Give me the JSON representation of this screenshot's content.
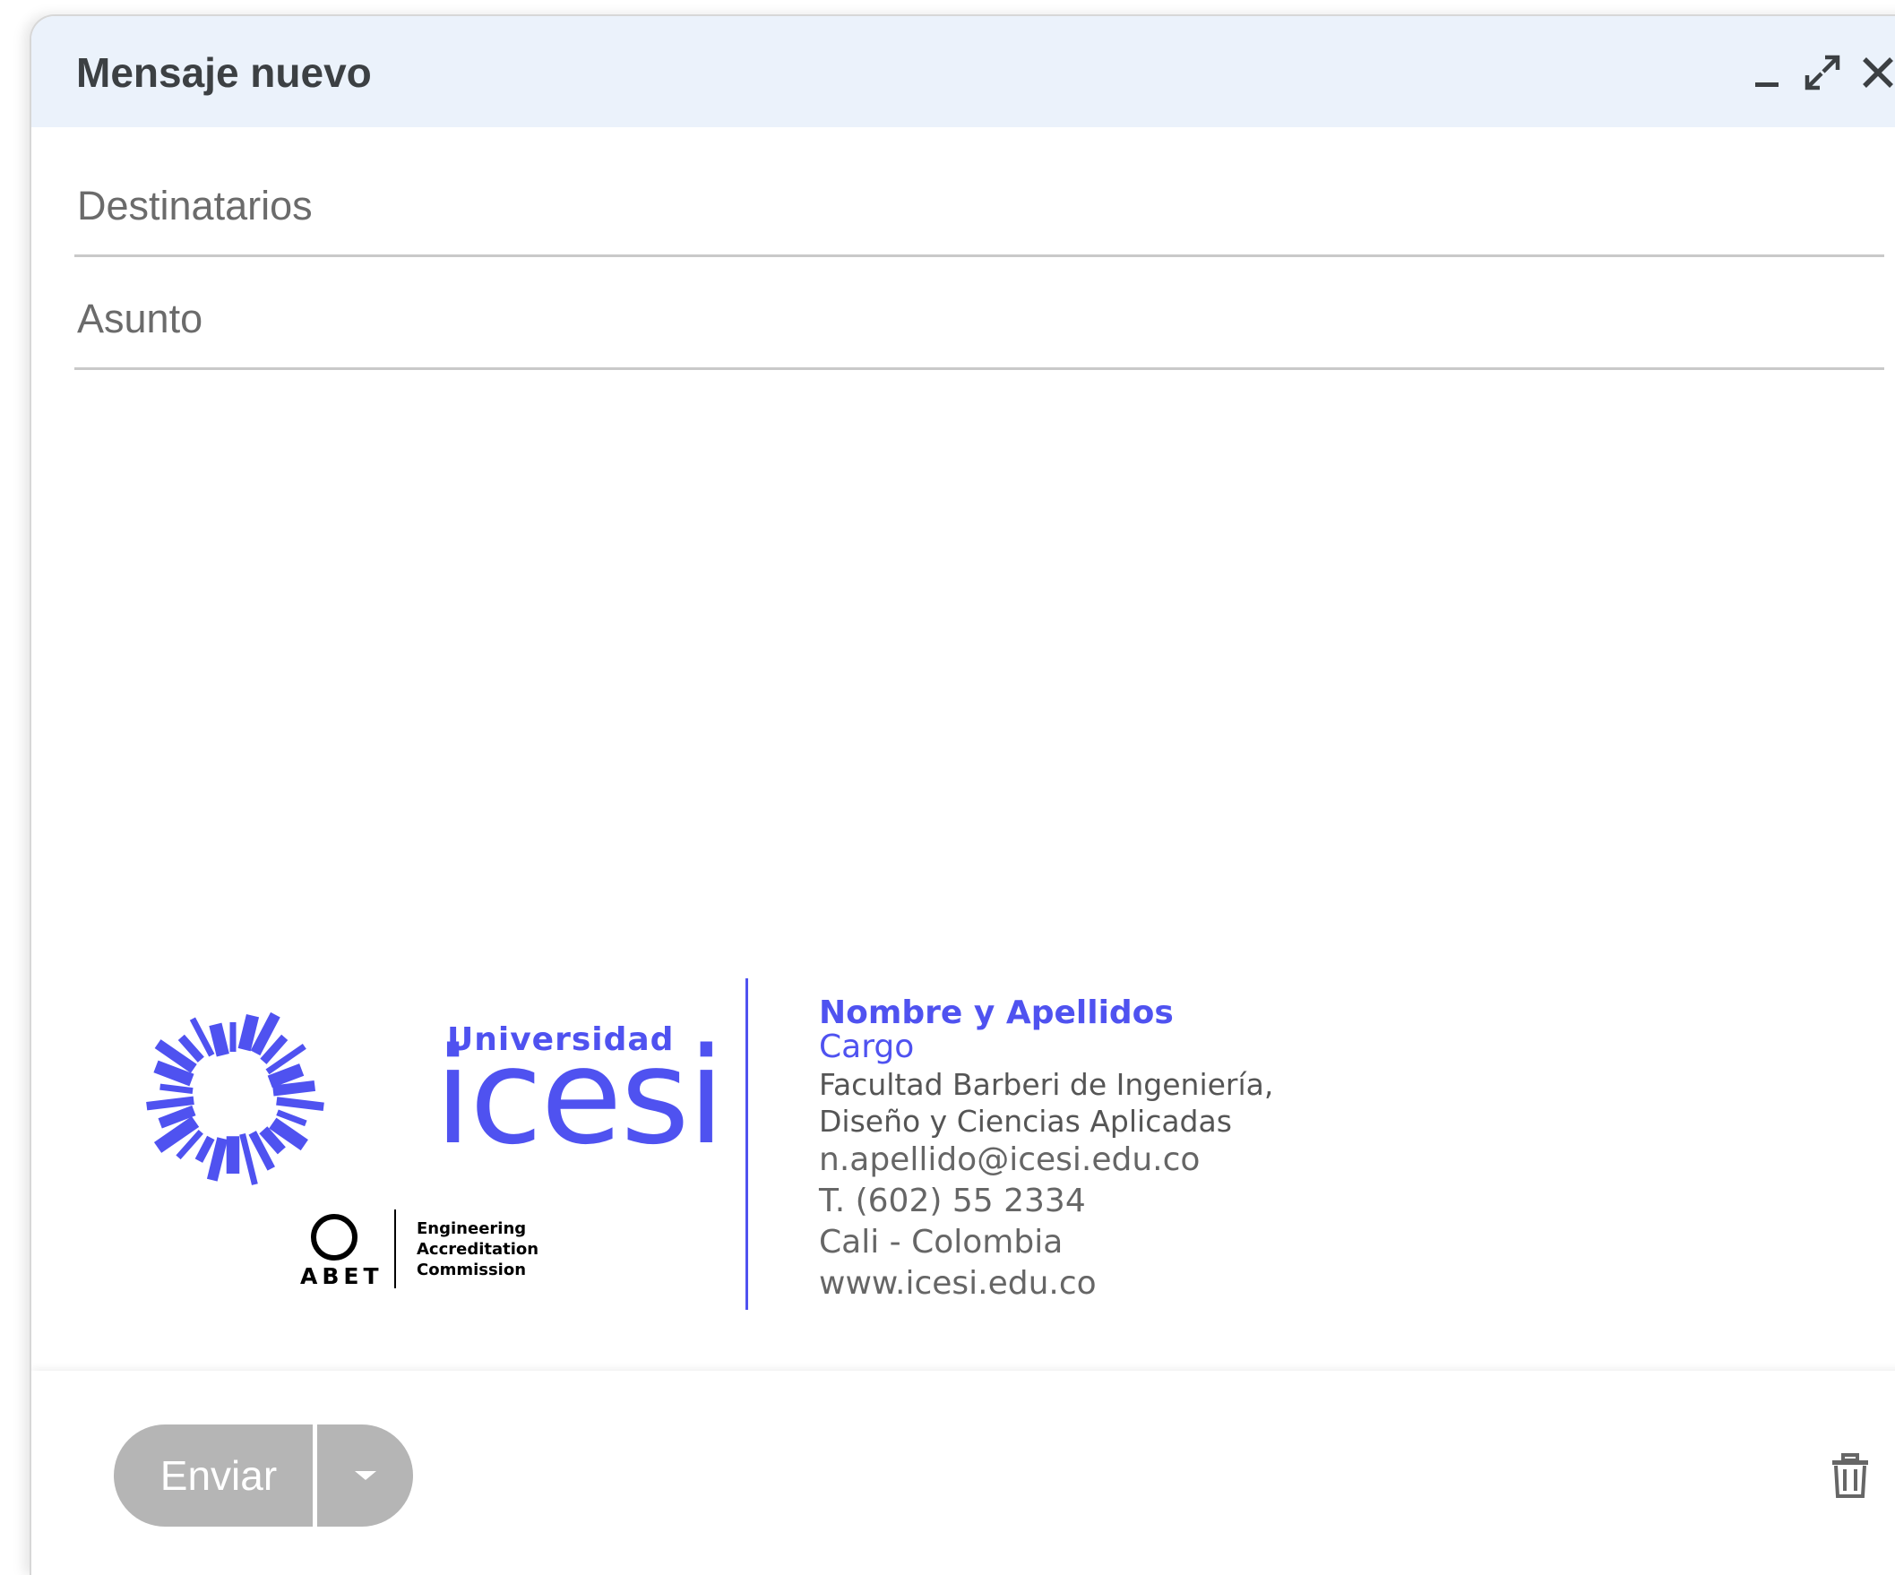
{
  "window": {
    "title": "Mensaje nuevo"
  },
  "fields": {
    "recipients_placeholder": "Destinatarios",
    "subject_placeholder": "Asunto"
  },
  "signature": {
    "logo_label_small": "Universidad",
    "logo_label_big": "icesi",
    "accreditation_mark": "ABET",
    "accreditation_lines": [
      "Engineering",
      "Accreditation",
      "Commission"
    ],
    "name": "Nombre y Apellidos",
    "role": "Cargo",
    "faculty_line_1": "Facultad Barberi de Ingeniería,",
    "faculty_line_2": "Diseño y Ciencias Aplicadas",
    "email": "n.apellido@icesi.edu.co",
    "phone": "T. (602) 55 2334",
    "city": "Cali - Colombia",
    "website": "www.icesi.edu.co"
  },
  "footer": {
    "send_label": "Enviar"
  },
  "icons": {
    "minimize": "minimize-icon",
    "expand": "expand-icon",
    "close": "close-icon",
    "send_options": "caret-down-icon",
    "delete": "trash-icon"
  },
  "colors": {
    "brand": "#4f52f0",
    "header_bg": "#ebf2fb",
    "send_disabled": "#b5b5b5"
  }
}
